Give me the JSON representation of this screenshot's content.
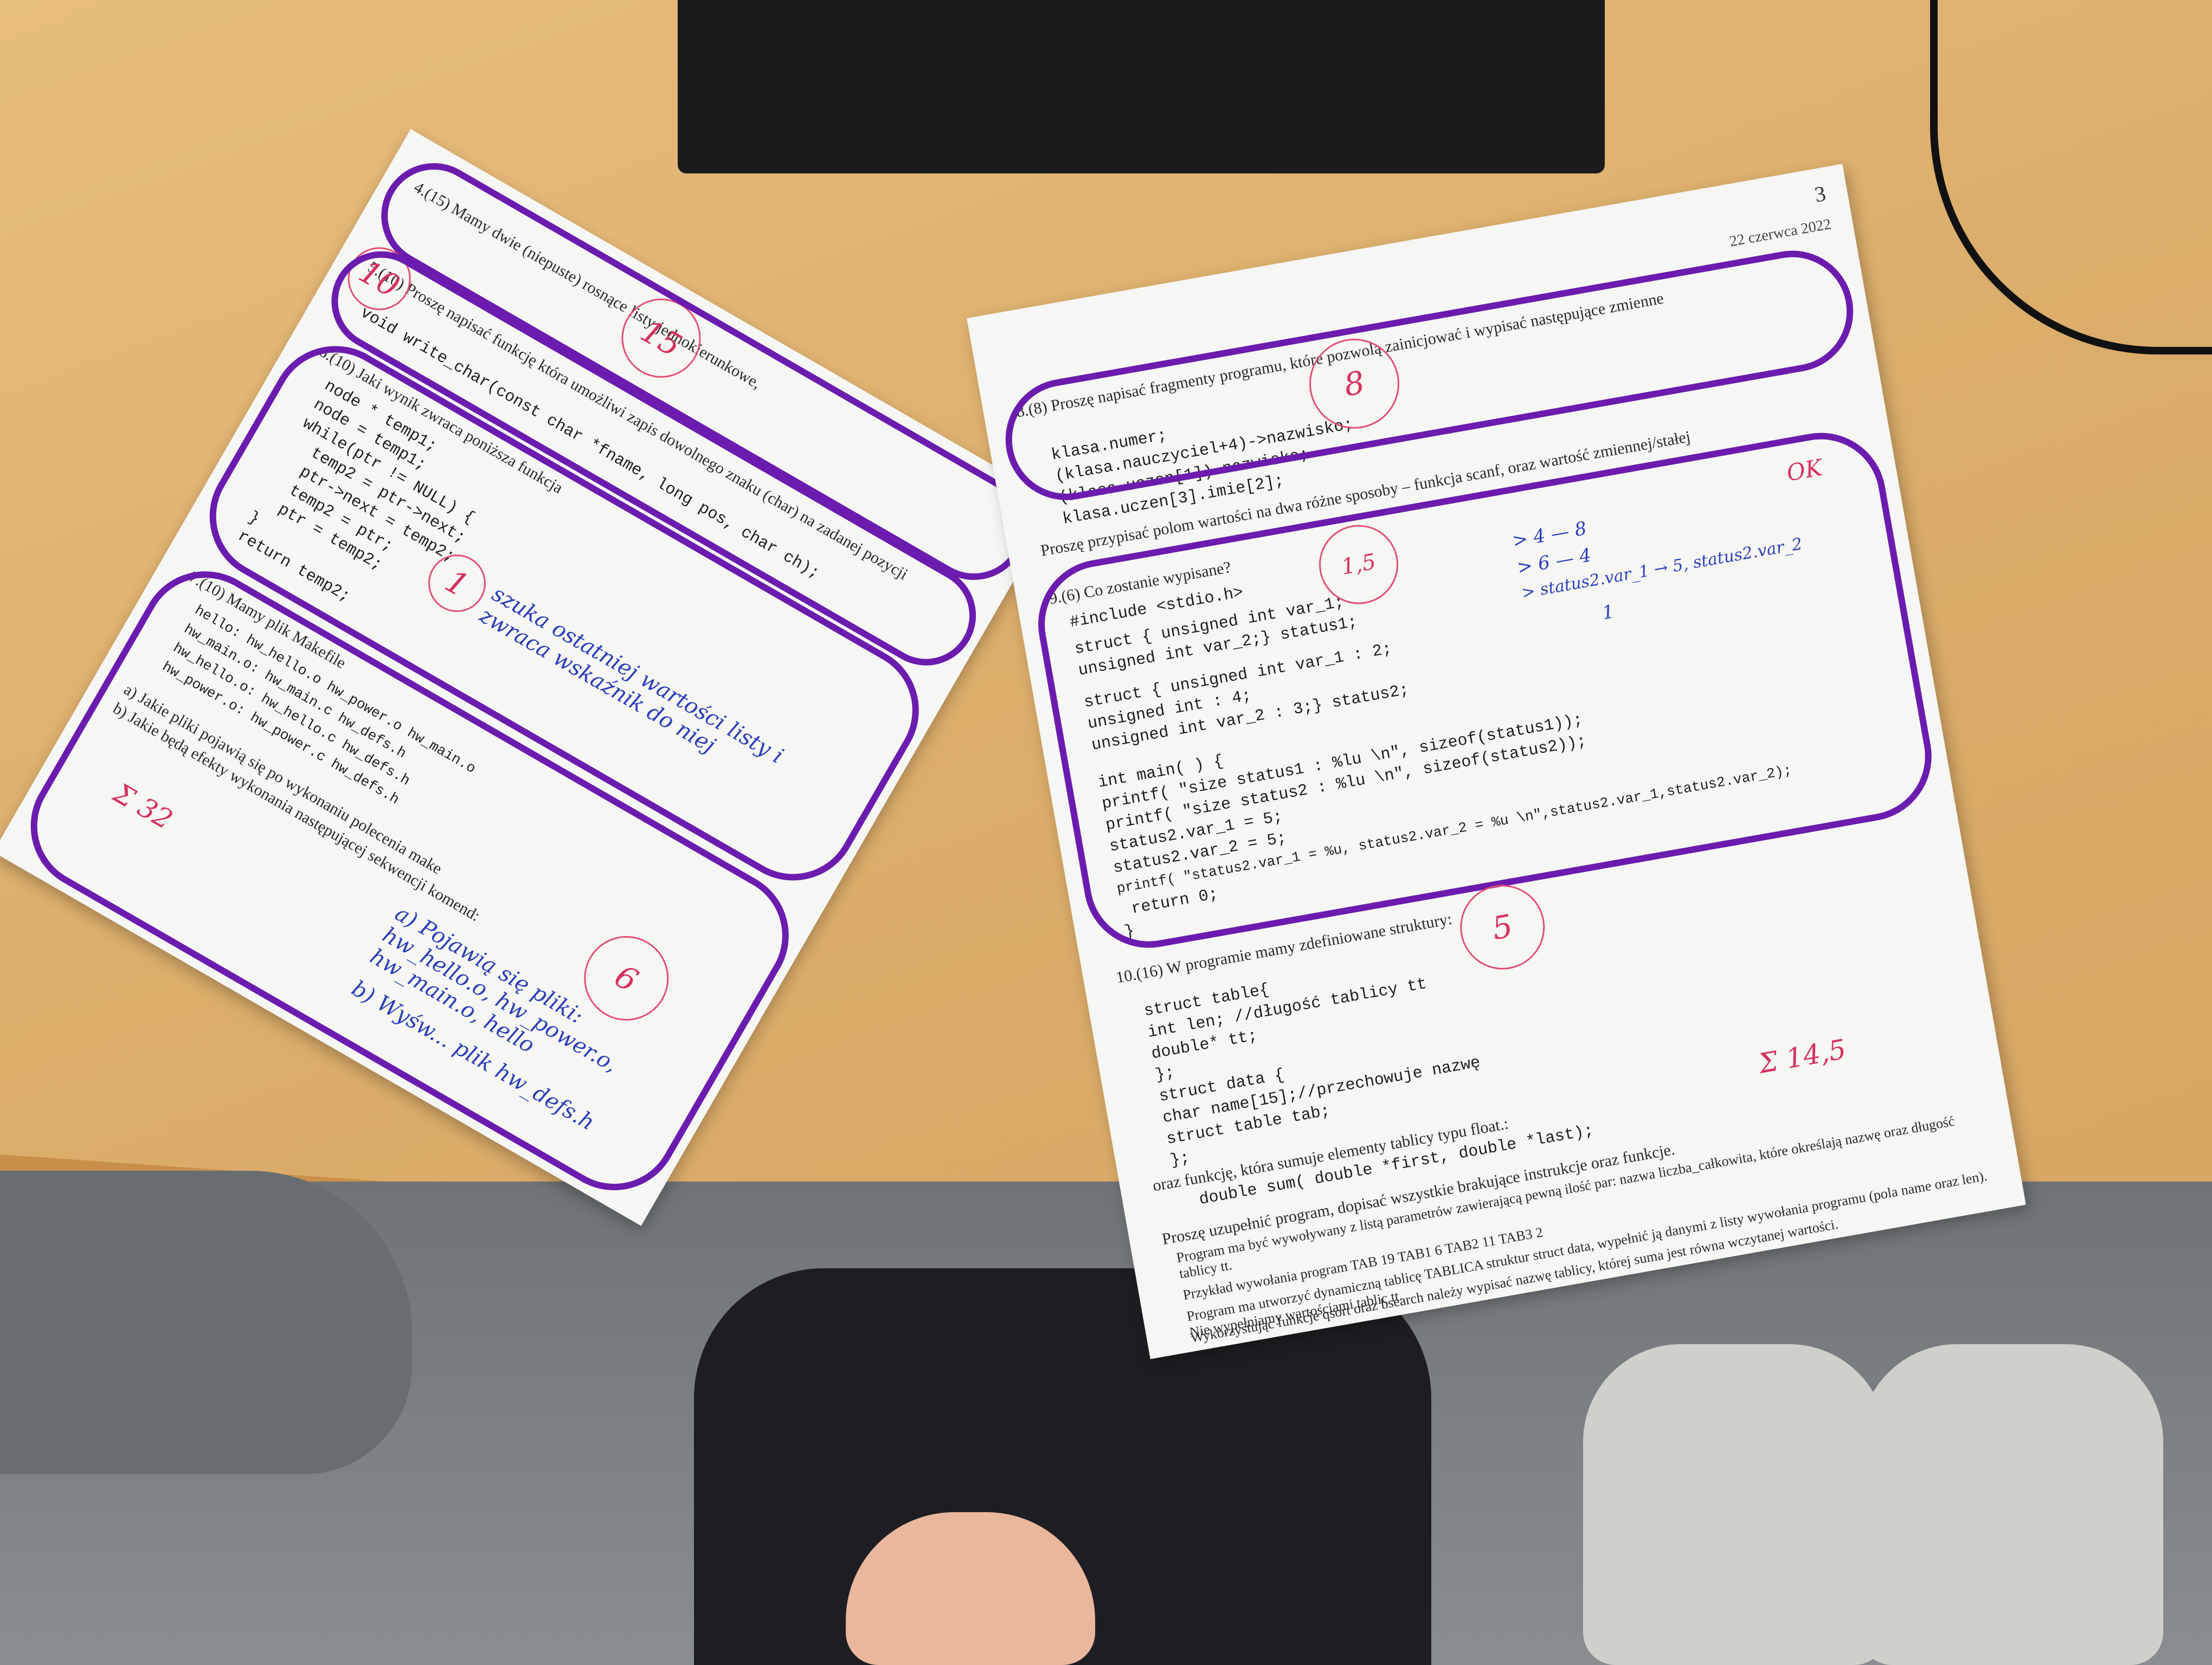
{
  "left_sheet": {
    "q4_text": "4.(15) Mamy dwie (niepuste) rosnące listy jednokierunkowe,",
    "q5_text": "5.(10) Proszę napisać funkcję która umożliwi zapis dowolnego znaku (char) na zadanej pozycji",
    "q5_code": "void write_char(const char *fname, long pos, char ch);",
    "q6_text": "6.(10) Jaki wynik zwraca poniższa funkcja",
    "q6_code": [
      "node * temp1;",
      "node = temp1;",
      "while(ptr != NULL) {",
      "temp2 = ptr->next;",
      "ptr->next = temp2;",
      "temp2 = ptr;",
      "ptr = temp2;",
      "}",
      "return temp2;"
    ],
    "q7_text": "7.(10) Mamy plik Makefile",
    "q7_make": [
      "hello: hw_hello.o hw_power.o hw_main.o",
      "hw_main.o: hw_main.c hw_defs.h",
      "hw_hello.o: hw_hello.c hw_defs.h",
      "hw_power.o: hw_power.c hw_defs.h"
    ],
    "q7_sub_a": "a) Jakie pliki pojawią się po wykonaniu polecenia make",
    "q7_sub_b": "b) Jakie będą efekty wykonania następującej sekwencji komend:",
    "answer_q6": "szuka ostatniej wartości listy i zwraca wskaźnik do niej",
    "answer_q7": "a) Pojawią się pliki: hw_hello.o, hw_power.o, hw_main.o, hello",
    "answer_q7b": "b) Wyśw... plik hw_defs.h",
    "grade_q4": "15",
    "grade_q5": "10",
    "grade_q6": "1",
    "grade_q7": "6",
    "total": "Σ 32"
  },
  "right_sheet": {
    "page_number": "3",
    "date": "22 czerwca 2022",
    "q8_text": "8.(8) Proszę napisać fragmenty programu, które pozwolą zainicjować i wypisać następujące zmienne",
    "q8_code": [
      "klasa.numer;",
      "(klasa.nauczyciel+4)->nazwisko;",
      "(klasa.uczen[1]).nazwisko;",
      "klasa.uczen[3].imie[2];"
    ],
    "q8_note": "Proszę przypisać polom wartości na dwa różne sposoby – funkcja scanf, oraz wartość zmiennej/stałej",
    "q9_text": "9.(6) Co zostanie wypisane?",
    "q9_code": [
      "#include <stdio.h>",
      "struct { unsigned int var_1;",
      "         unsigned int var_2;} status1;",
      "struct { unsigned int var_1 : 2;",
      "         unsigned int       : 4;",
      "         unsigned int var_2 : 3;} status2;",
      "int main( ) {",
      "printf( \"size status1 : %lu \\n\", sizeof(status1));",
      "printf( \"size status2 : %lu \\n\", sizeof(status2));",
      "status2.var_1 = 5;",
      "status2.var_2 = 5;",
      "printf( \"status2.var_1 = %u, status2.var_2 = %u \\n\",status2.var_1,status2.var_2);",
      "  return 0;",
      "}"
    ],
    "q9_answer": [
      "> 4 — 8",
      "> 6 — 4",
      "> status2.var_1 → 5, status2.var_2",
      "1"
    ],
    "q9_ok": "OK",
    "q10_text": "10.(16) W programie mamy zdefiniowane struktury:",
    "q10_code": [
      "struct table{",
      "  int len; //długość tablicy tt",
      "  double* tt;",
      "};",
      "struct data {",
      "  char name[15];//przechowuje nazwę",
      "  struct table tab;",
      "};"
    ],
    "q10_func_intro": "oraz funkcję, która sumuje elementy tablicy typu float.:",
    "q10_func": "double sum( double *first, double *last);",
    "q10_task": "Proszę uzupełnić program, dopisać wszystkie brakujące instrukcje oraz funkcje.",
    "q10_bullets": [
      "Program ma być wywoływany z listą parametrów zawierającą pewną ilość par: nazwa liczba_całkowita, które określają nazwę oraz długość tablicy tt.",
      "Przykład wywołania   program TAB 19 TAB1 6 TAB2 11 TAB3 2",
      "Program ma utworzyć dynamiczną tablicę TABLICA struktur struct data, wypełnić ją danymi z listy wywołania programu (pola name oraz len). Nie wypełniamy wartościami tablic tt.",
      "Wykorzystując funkcje qsort oraz bsearch należy wypisać nazwę tablicy, której suma jest równa wczytanej wartości."
    ],
    "grade_q8": "8",
    "grade_q9": "1,5",
    "grade_q10": "5",
    "total": "Σ 14,5"
  }
}
